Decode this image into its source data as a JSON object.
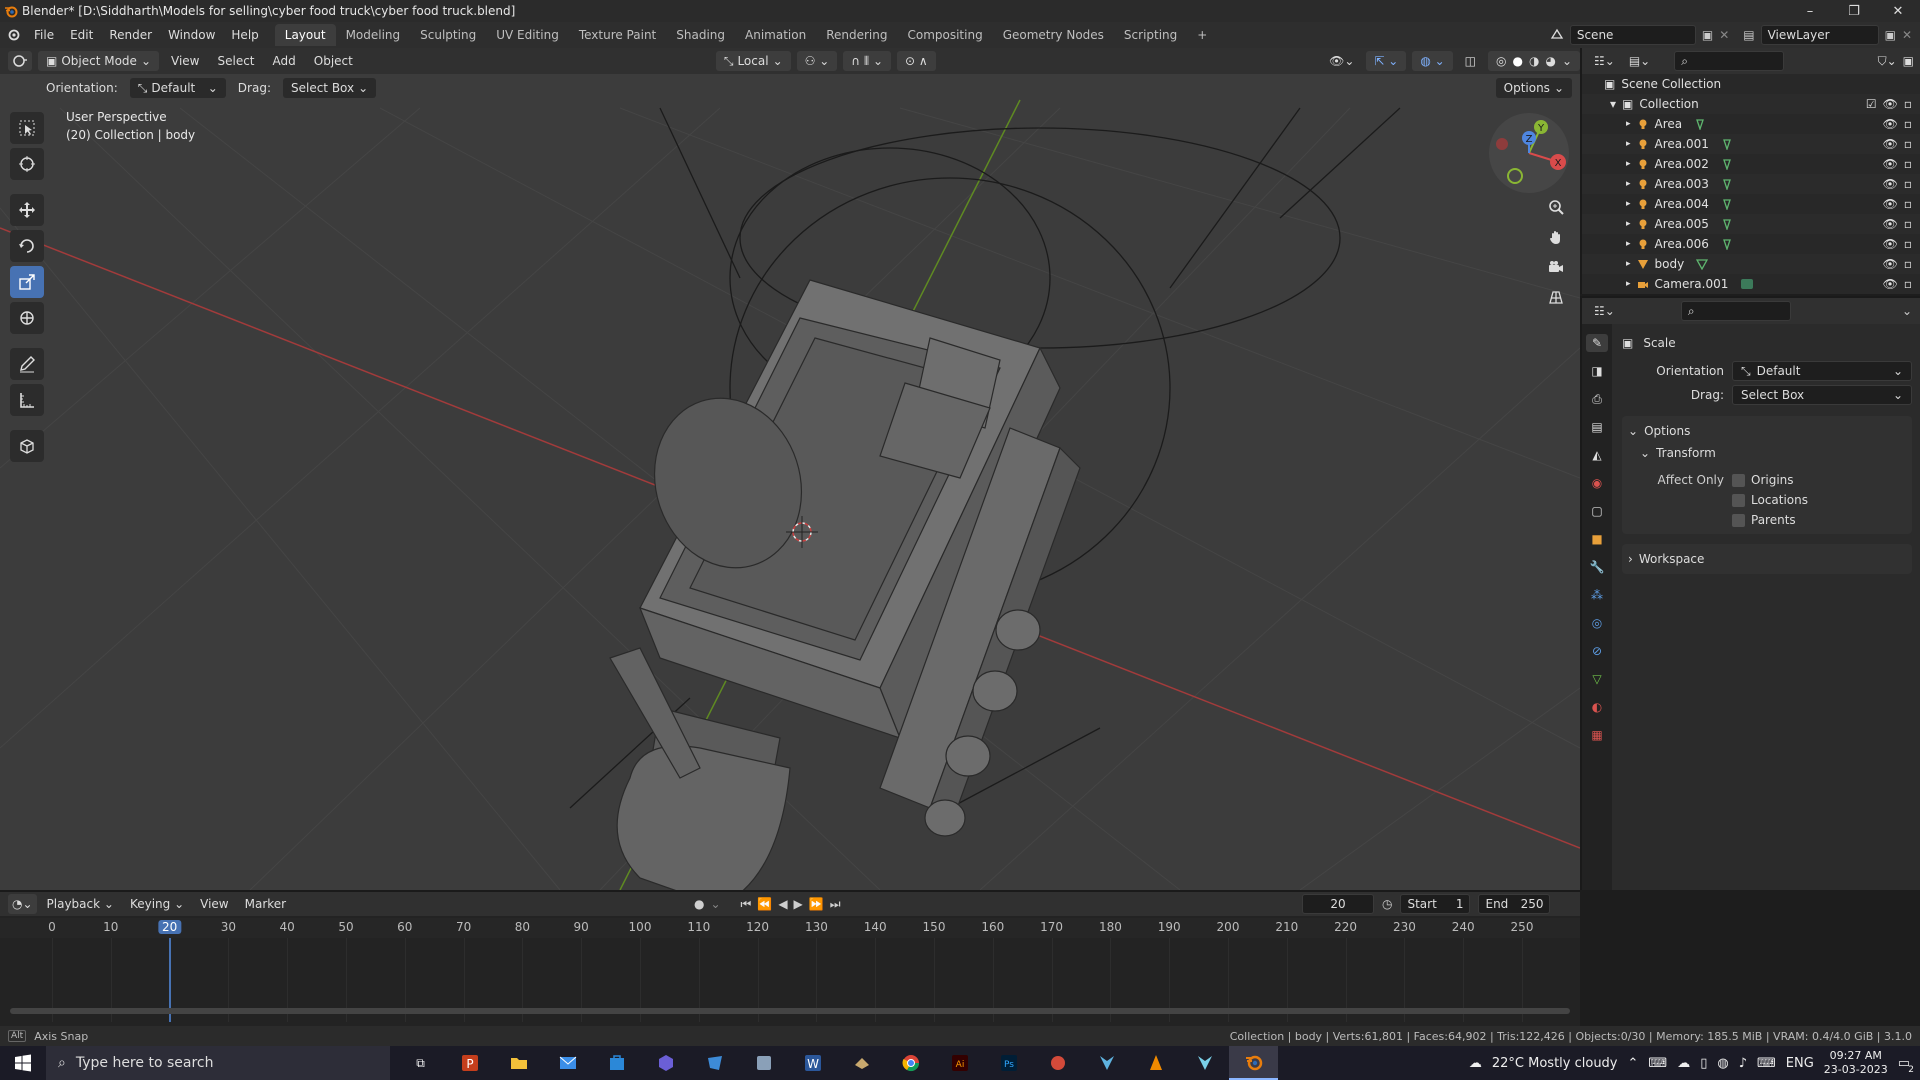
{
  "title_bar": {
    "title": "Blender* [D:\\Siddharth\\Models for selling\\cyber food truck\\cyber food truck.blend]",
    "minimize": "–",
    "maximize": "❐",
    "close": "✕"
  },
  "menu": [
    "File",
    "Edit",
    "Render",
    "Window",
    "Help"
  ],
  "workspaces": [
    "Layout",
    "Modeling",
    "Sculpting",
    "UV Editing",
    "Texture Paint",
    "Shading",
    "Animation",
    "Rendering",
    "Compositing",
    "Geometry Nodes",
    "Scripting"
  ],
  "add_workspace": "+",
  "scene_name": "Scene",
  "view_layer": "ViewLayer",
  "viewport_header": {
    "mode": "Object Mode",
    "menus": [
      "View",
      "Select",
      "Add",
      "Object"
    ],
    "pivot": "Local"
  },
  "tool_header": {
    "orientation_label": "Orientation:",
    "orientation_value": "Default",
    "drag_label": "Drag:",
    "drag_value": "Select Box",
    "options": "Options"
  },
  "viewport_overlay": {
    "view_name": "User Perspective",
    "collection_info": "(20) Collection | body"
  },
  "gizmo": {
    "x": "X",
    "y": "Y",
    "z": "Z"
  },
  "outliner": {
    "root": "Scene Collection",
    "collection": "Collection",
    "items": [
      {
        "name": "Area",
        "icon": "light-icon"
      },
      {
        "name": "Area.001",
        "icon": "light-icon"
      },
      {
        "name": "Area.002",
        "icon": "light-icon"
      },
      {
        "name": "Area.003",
        "icon": "light-icon"
      },
      {
        "name": "Area.004",
        "icon": "light-icon"
      },
      {
        "name": "Area.005",
        "icon": "light-icon"
      },
      {
        "name": "Area.006",
        "icon": "light-icon"
      },
      {
        "name": "body",
        "icon": "mesh-icon"
      },
      {
        "name": "Camera.001",
        "icon": "camera-icon"
      }
    ]
  },
  "properties": {
    "tool_name": "Scale",
    "orientation_label": "Orientation",
    "orientation_value": "Default",
    "drag_label": "Drag:",
    "drag_value": "Select Box",
    "options_panel": "Options",
    "transform_panel": "Transform",
    "affect_only_label": "Affect Only",
    "affect_only": [
      "Origins",
      "Locations",
      "Parents"
    ],
    "workspace_panel": "Workspace"
  },
  "timeline": {
    "menus": [
      "Playback",
      "Keying",
      "View",
      "Marker"
    ],
    "current_frame": "20",
    "start_label": "Start",
    "start": "1",
    "end_label": "End",
    "end": "250",
    "ruler": [
      "0",
      "10",
      "20",
      "30",
      "40",
      "50",
      "60",
      "70",
      "80",
      "90",
      "100",
      "110",
      "120",
      "130",
      "140",
      "150",
      "160",
      "170",
      "180",
      "190",
      "200",
      "210",
      "220",
      "230",
      "240",
      "250"
    ]
  },
  "status_bar": {
    "left": "Axis Snap",
    "left_key": "Alt",
    "right": "Collection | body | Verts:61,801 | Faces:64,902 | Tris:122,426 | Objects:0/30 | Memory: 185.5 MiB | VRAM: 0.4/4.0 GiB | 3.1.0"
  },
  "taskbar": {
    "search_placeholder": "Type here to search",
    "weather": "22°C  Mostly cloudy",
    "language": "ENG",
    "time": "09:27 AM",
    "date": "23-03-2023",
    "notifications": "2"
  },
  "colors": {
    "accent": "#4772b3",
    "x_axis": "#c04545",
    "y_axis": "#6f9c2a"
  }
}
